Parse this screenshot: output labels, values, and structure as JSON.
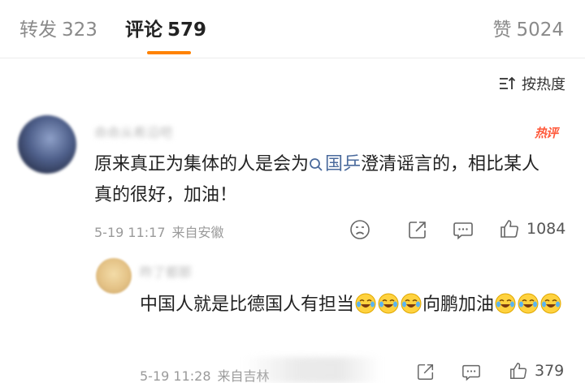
{
  "tabs": {
    "repost": {
      "label": "转发",
      "count": "323"
    },
    "comment": {
      "label": "评论",
      "count": "579"
    },
    "like": {
      "label": "赞",
      "count": "5024"
    }
  },
  "sort": {
    "label": "按热度"
  },
  "comment": {
    "username": "命命从希沿吧",
    "badge": "热评",
    "text_before": "原来真正为集体的人是会为",
    "search_term": "国乒",
    "text_after": "澄清谣言的，相比某人真的很好，加油！",
    "date": "5-19 11:17",
    "source": "来自安徽",
    "like_count": "1084"
  },
  "reply": {
    "username": "昨了都那",
    "text": "中国人就是比德国人有担当",
    "text_2": "向鹏加油",
    "emoji_name": "crying-laughing-emoji",
    "date": "5-19 11:28",
    "source": "来自吉林",
    "like_count": "379"
  },
  "colors": {
    "accent": "#ff8200",
    "hot": "#ff5a3c",
    "link": "#4a6a9c"
  }
}
